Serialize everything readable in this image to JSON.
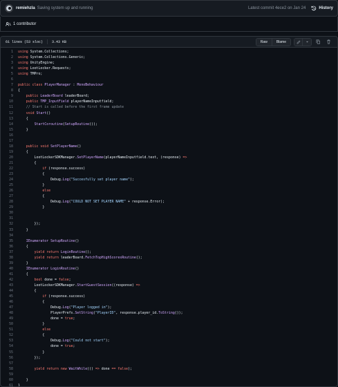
{
  "commit": {
    "author": "remiehzla",
    "message": "Saving system up and running",
    "latest": "Latest commit 4ece2 on Jan 24",
    "history_label": "History"
  },
  "contributors": {
    "label": "1 contributor"
  },
  "file": {
    "lines_info": "61 lines (53 sloc)",
    "size": "3.43 KB",
    "raw_label": "Raw",
    "blame_label": "Blame"
  },
  "colors": {
    "keyword": "#ff7b72",
    "type": "#d2a8ff",
    "string": "#a5d6ff",
    "comment": "#8b949e",
    "background": "#0d1117"
  },
  "code_lines": [
    "using System.Collections;",
    "using System.Collections.Generic;",
    "using UnityEngine;",
    "using LootLocker.Requests;",
    "using TMPro;",
    "",
    "public class PlayerManager : MonoBehaviour",
    "{",
    "    public LeaderBoard leaderBoard;",
    "    public TMP_InputField playerNameInputfield;",
    "    // Start is called before the first frame update",
    "    void Start()",
    "    {",
    "        StartCoroutine(SetupRoutine());",
    "    }",
    "",
    "",
    "    public void SetPlayerName()",
    "    {",
    "        LootLockerSDKManager.SetPlayerName(playerNameInputfield.text, (response) =>",
    "        {",
    "            if (response.success)",
    "            {",
    "                Debug.Log(\"Succesfully set player name\");",
    "            }",
    "            else",
    "            {",
    "                Debug.Log(\"COULD NOT SET PLAYER NAME\" + response.Error);",
    "            }",
    "",
    "",
    "        });",
    "    }",
    "",
    "    IEnumerator SetupRoutine()",
    "    {",
    "        yield return LoginRoutine();",
    "        yield return leaderBoard.FetchTopHighScoresRoutine();",
    "    }",
    "    IEnumerator LoginRoutine()",
    "    {",
    "        bool done = false;",
    "        LootLockerSDKManager.StartGuestSession((response) =>",
    "        {",
    "            if (response.success)",
    "            {",
    "                Debug.Log(\"Player logged in\");",
    "                PlayerPrefs.SetString(\"PlayerID\", response.player_id.ToString());",
    "                done = true;",
    "            }",
    "            else",
    "            {",
    "                Debug.Log(\"Could not start\");",
    "                done = true;",
    "            }",
    "        });",
    "",
    "        yield return new WaitWhile(() => done == false);",
    "",
    "    }",
    "}"
  ]
}
